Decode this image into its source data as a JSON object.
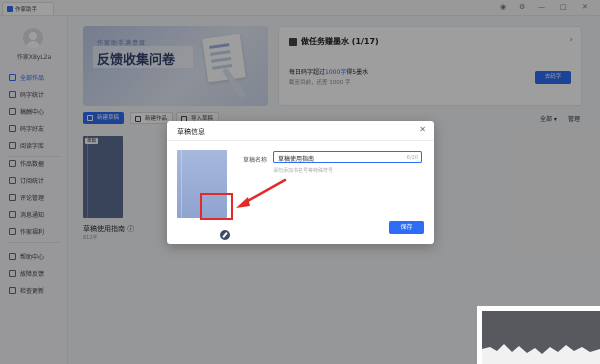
{
  "window": {
    "tab_label": "作家助手",
    "controls": [
      "◉",
      "⚙",
      "—",
      "□",
      "✕"
    ]
  },
  "sidebar": {
    "username": "作家X8yL2a",
    "items": [
      {
        "label": "全部作品",
        "active": true
      },
      {
        "label": "码字统计",
        "active": false
      },
      {
        "label": "稿酬中心",
        "active": false
      },
      {
        "label": "码字好友",
        "active": false
      },
      {
        "label": "阅读字库",
        "active": false
      },
      {
        "label": "作品数据",
        "active": false
      },
      {
        "label": "订阅统计",
        "active": false
      },
      {
        "label": "评论管理",
        "active": false
      },
      {
        "label": "消息通知",
        "active": false
      },
      {
        "label": "作家福利",
        "active": false
      },
      {
        "label": "帮助中心",
        "active": false
      },
      {
        "label": "故障反馈",
        "active": false
      },
      {
        "label": "检查更新",
        "active": false
      }
    ]
  },
  "banner": {
    "subtitle": "作家助手满意度",
    "title": "反馈收集问卷"
  },
  "task_card": {
    "title": "做任务赚墨水 (1/17)",
    "desc_prefix": "每日码字超过",
    "desc_highlight": "1000字",
    "desc_suffix": "得5墨水",
    "progress": "截至目前，还差 1000 字",
    "button": "去码字"
  },
  "toolbar": {
    "new_draft": "新建草稿",
    "new_work": "新建作品",
    "import_draft": "导入草稿",
    "filter_all": "全部 ▾",
    "manage": "管理"
  },
  "book": {
    "tag": "草稿",
    "title": "草稿使用指南 ⓘ",
    "count": "812字"
  },
  "modal": {
    "title": "草稿信息",
    "close": "✕",
    "field_label": "草稿名称",
    "field_value": "草稿使用指南",
    "field_count": "6/20",
    "field_hint": "请勿添加书名号等特殊符号",
    "save": "保存"
  },
  "colors": {
    "accent": "#2f6cf6",
    "highlight": "#e12b2b"
  }
}
